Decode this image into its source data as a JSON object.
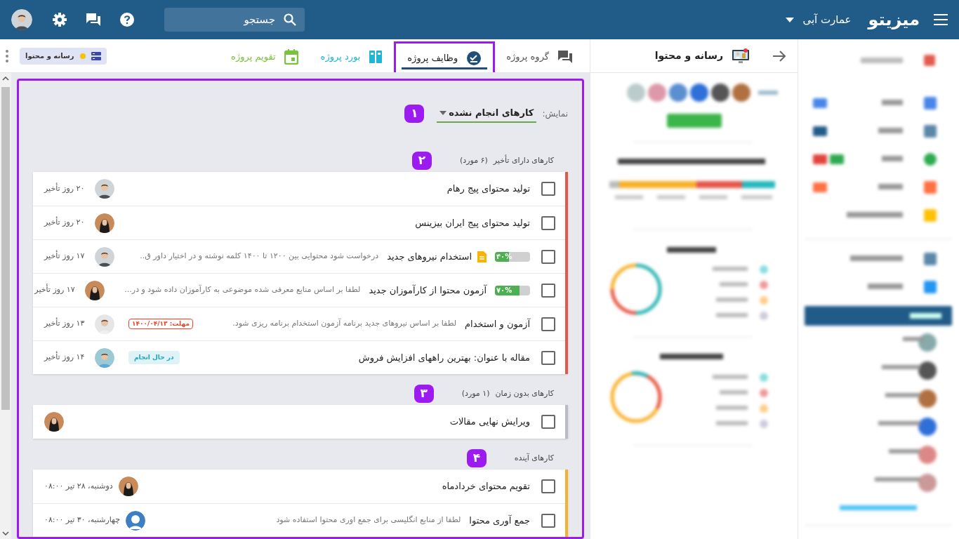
{
  "topbar": {
    "brand": "میزیتو",
    "workspace": "عمارت آبی",
    "search": {
      "placeholder": "جستجو"
    },
    "user_avatar": {
      "kind": "man"
    }
  },
  "side_panel": {
    "title": "رسانه و محتوا"
  },
  "tabs": [
    {
      "label": "گروه پروژه",
      "kind": "chat",
      "color": "#555555",
      "selected": false
    },
    {
      "label": "وظایف پروژه",
      "kind": "tasks",
      "color": "#1f4e79",
      "selected": true
    },
    {
      "label": "بورد پروژه",
      "kind": "board",
      "color": "#1fb6d5",
      "selected": false
    },
    {
      "label": "تقویم پروژه",
      "kind": "calendar",
      "color": "#7cc242",
      "selected": false
    }
  ],
  "project_chip": {
    "label": "رسانه و محتوا"
  },
  "filter": {
    "marker": "۱",
    "label": "نمایش:",
    "value": "کارهای انجام نشده"
  },
  "groups": [
    {
      "marker": "۲",
      "title": "کارهای دارای تأخیر",
      "count": "(۶ مورد)",
      "color": "#e5574b",
      "tasks": [
        {
          "title": "تولید محتوای پیج رهام",
          "checked": false,
          "avatar": {
            "kind": "man"
          },
          "when": "۲۰ روز تأخیر"
        },
        {
          "title": "تولید محتوای پیج ایران بیزینس",
          "checked": false,
          "avatar": {
            "kind": "woman"
          },
          "when": "۲۰ روز تأخیر"
        },
        {
          "title": "استخدام نیروهای جدید",
          "checked": false,
          "progress": {
            "level": 0.4,
            "label": "۴۰%"
          },
          "attachment": true,
          "description": "درخواست شود محتوایی بین ۱۲۰۰ تا ۱۴۰۰ کلمه نوشته و در اختیار داور ق..",
          "avatar": {
            "kind": "man"
          },
          "when": "۱۷ روز تأخیر"
        },
        {
          "title": "آزمون محتوا از کارآموزان جدید",
          "checked": false,
          "progress": {
            "level": 0.7,
            "label": "۷۰%"
          },
          "description": "لطفا بر اساس منابع معرفی شده موضوعی به کارآموزان داده شود و در...",
          "avatar": {
            "kind": "woman"
          },
          "when": "۱۷ روز تأخیر"
        },
        {
          "title": "آزمون و استخدام",
          "checked": false,
          "description": "لطفا بر اساس نیروهای جدید برنامه آزمون استخدام برنامه ریزی شود.",
          "deadline": "مهلت: ۱۴۰۰/۰۴/۱۳",
          "avatar": {
            "kind": "man_light"
          },
          "when": "۱۳ روز تأخیر"
        },
        {
          "title": "مقاله با عنوان: بهترین راههای افزایش فروش",
          "checked": false,
          "status": "در حال انجام",
          "avatar": {
            "kind": "man_smile"
          },
          "when": "۱۴ روز تأخیر"
        }
      ]
    },
    {
      "marker": "۳",
      "title": "کارهای بدون زمان",
      "count": "(۱ مورد)",
      "color": "#b9bcc4",
      "tasks": [
        {
          "title": "ویرایش نهایی مقالات",
          "checked": false,
          "avatar": {
            "kind": "woman"
          }
        }
      ]
    },
    {
      "marker": "۴",
      "title": "کارهای آینده",
      "color": "#f7b12b",
      "tasks": [
        {
          "title": "تقویم محتوای خردادماه",
          "checked": false,
          "avatar": {
            "kind": "woman"
          },
          "when": "دوشنبه، ۲۸ تیر ۰۸:۰۰"
        },
        {
          "title": "جمع آوری محتوا",
          "checked": false,
          "description": "لطفا از منابع انگلیسی برای جمع اوری محتوا استفاده شود",
          "avatar": {
            "kind": "placeholder"
          },
          "when": "چهارشنبه، ۳۰ تیر ۰۸:۰۰"
        }
      ]
    }
  ]
}
